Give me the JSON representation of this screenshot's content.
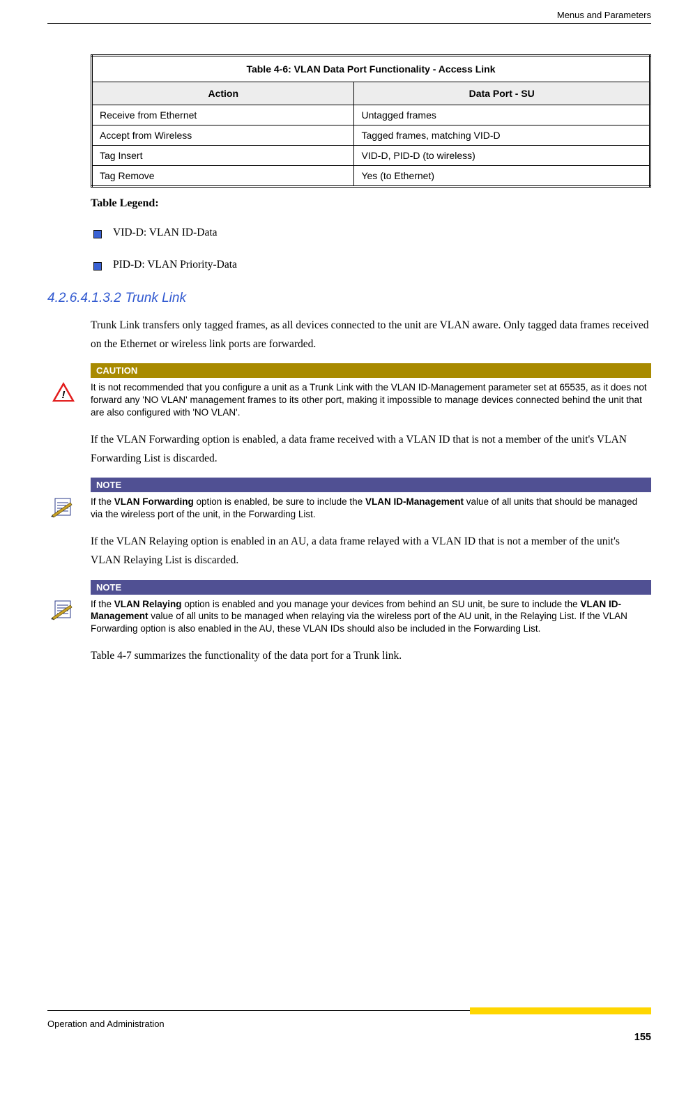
{
  "header": {
    "right": "Menus and Parameters"
  },
  "table46": {
    "title": "Table 4-6: VLAN Data Port Functionality - Access Link",
    "col1": "Action",
    "col2": "Data Port - SU",
    "rows": [
      {
        "a": "Receive from Ethernet",
        "b": "Untagged frames"
      },
      {
        "a": "Accept from Wireless",
        "b": "Tagged frames, matching VID-D"
      },
      {
        "a": "Tag Insert",
        "b": "VID-D, PID-D (to wireless)"
      },
      {
        "a": "Tag Remove",
        "b": "Yes (to Ethernet)"
      }
    ]
  },
  "legend": {
    "title": "Table Legend:",
    "items": [
      "VID-D: VLAN ID-Data",
      "PID-D: VLAN Priority-Data"
    ]
  },
  "section": {
    "num": "4.2.6.4.1.3.2",
    "title": "Trunk Link"
  },
  "para1": "Trunk Link transfers only tagged frames, as all devices connected to the unit are VLAN aware. Only tagged data frames received on the Ethernet or wireless link ports are forwarded.",
  "caution": {
    "label": "CAUTION",
    "text": "It is not recommended that you configure a unit as a Trunk Link with the VLAN ID-Management parameter set at 65535, as it does not forward any 'NO VLAN' management frames to its other port, making it impossible to manage devices connected behind the unit that are also configured with 'NO VLAN'."
  },
  "para2": "If the VLAN Forwarding option is enabled, a data frame received with a VLAN ID that is not a member of the unit's VLAN Forwarding List is discarded.",
  "note1": {
    "label": "NOTE",
    "pre": "If the ",
    "b1": "VLAN Forwarding",
    "mid1": " option is enabled, be sure to include the ",
    "b2": "VLAN ID-Management",
    "post": " value of all units that should be managed via the wireless port of the unit, in the Forwarding List."
  },
  "para3": "If the VLAN Relaying option is enabled in an AU, a data frame relayed with a VLAN ID that is not a member of the unit's VLAN Relaying List is discarded.",
  "note2": {
    "label": "NOTE",
    "pre": "If the ",
    "b1": "VLAN Relaying",
    "mid1": " option is enabled and you manage your devices from behind an SU unit, be sure to include the ",
    "b2": "VLAN ID-Management",
    "post": " value of all units to be managed when relaying via the wireless port of the AU unit, in the Relaying List. If the VLAN Forwarding option is also enabled in the AU, these VLAN IDs should also be included in the Forwarding List."
  },
  "para4": "Table 4-7 summarizes the functionality of the data port for a Trunk link.",
  "footer": {
    "left": "Operation and Administration",
    "page": "155"
  }
}
